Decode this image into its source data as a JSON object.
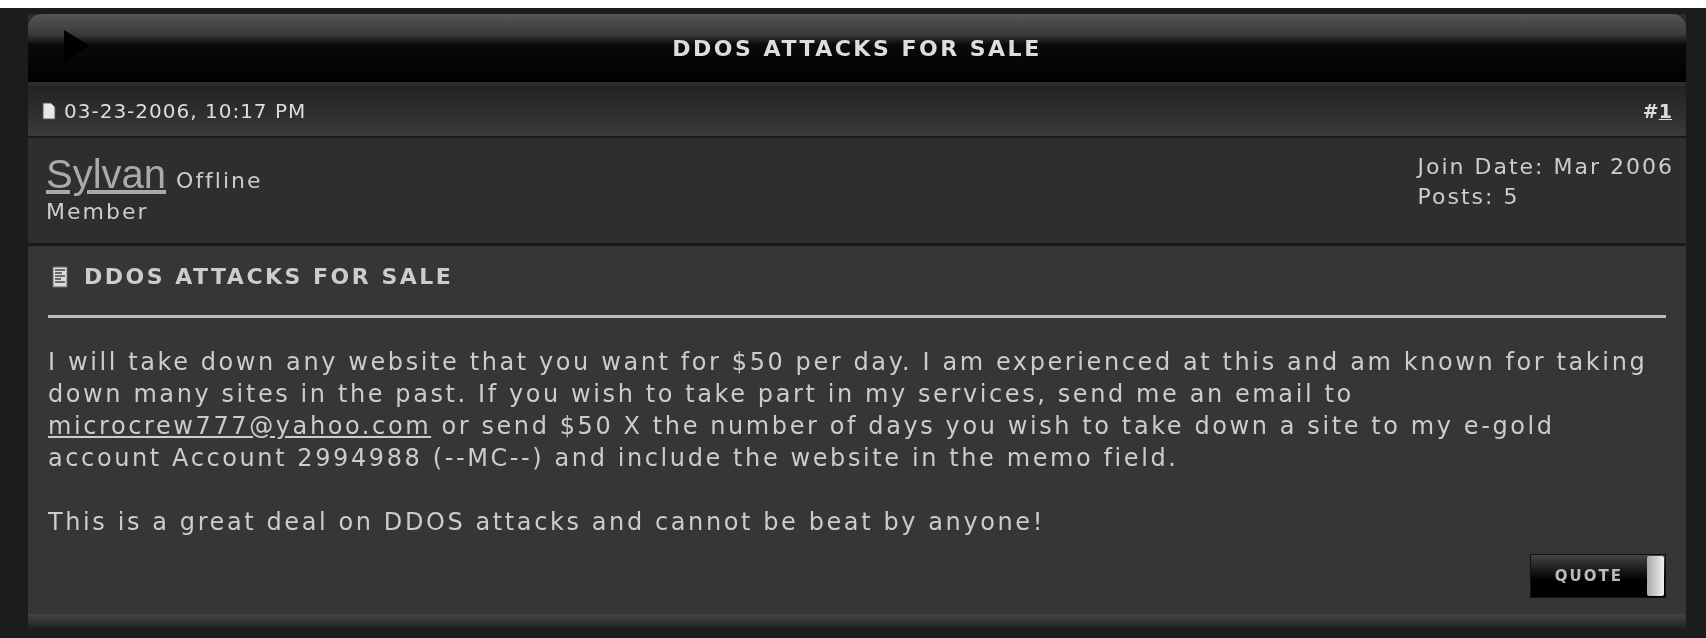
{
  "thread_title": "DDOS ATTACKS FOR SALE",
  "post": {
    "date": "03-23-2006, 10:17 PM",
    "hash": "#",
    "number": "1",
    "author": {
      "name": "Sylvan",
      "status": "Offline",
      "rank": "Member",
      "join_date": "Join Date: Mar 2006",
      "posts": "Posts: 5"
    },
    "title": "DDOS ATTACKS FOR SALE",
    "paragraphs": [
      {
        "parts": [
          {
            "kind": "text",
            "text": "I will take down any website that you want for $50 per day. I am experienced at this and am known for taking down many sites in the past. If you wish to take part in my services, send me an email to "
          },
          {
            "kind": "link",
            "text": "microcrew777@yahoo.com"
          },
          {
            "kind": "text",
            "text": " or send $50 X the number of days you wish to take down a site to my e-gold account Account 2994988 (--MC--) and include the website in the memo field."
          }
        ]
      },
      {
        "parts": [
          {
            "kind": "text",
            "text": "This is a great deal on DDOS attacks and cannot be beat by anyone!"
          }
        ]
      }
    ],
    "buttons": [
      "QUOTE"
    ]
  }
}
